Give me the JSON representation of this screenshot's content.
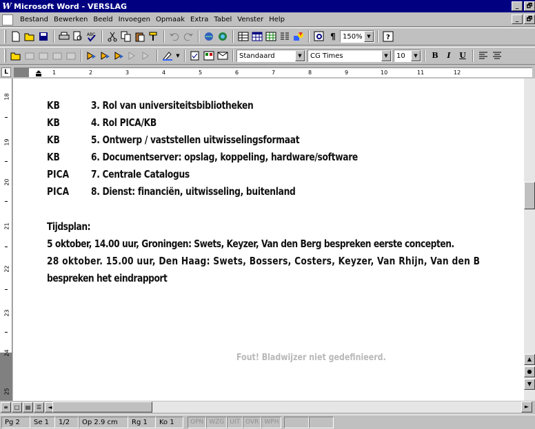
{
  "window": {
    "title": "Microsoft Word - VERSLAG",
    "logo": "W",
    "minimize": "_",
    "restore": "🗗",
    "close": "✕"
  },
  "menu": [
    "Bestand",
    "Bewerken",
    "Beeld",
    "Invoegen",
    "Opmaak",
    "Extra",
    "Tabel",
    "Venster",
    "Help"
  ],
  "toolbar1": {
    "zoom": "150%"
  },
  "toolbar2": {
    "style": "Standaard",
    "font": "CG Times",
    "size": "10",
    "bold": "B",
    "italic": "I",
    "underline": "U"
  },
  "ruler": {
    "tab_selector": "L",
    "ticks": [
      "1",
      "2",
      "3",
      "4",
      "5",
      "6",
      "7",
      "8",
      "9",
      "10",
      "11",
      "12"
    ],
    "vticks": [
      "18",
      "19",
      "20",
      "21",
      "22",
      "23",
      "24",
      "25"
    ]
  },
  "document": {
    "rows": [
      {
        "org": "KB",
        "item": "3. Rol van universiteitsbibliotheken"
      },
      {
        "org": "KB",
        "item": "4. Rol PICA/KB"
      },
      {
        "org": "KB",
        "item": "5. Ontwerp / vaststellen uitwisselingsformaat"
      },
      {
        "org": "KB",
        "item": "6. Documentserver: opslag, koppeling, hardware/software"
      },
      {
        "org": "PICA",
        "item": "7. Centrale Catalogus"
      },
      {
        "org": "PICA",
        "item": "8. Dienst: financiën, uitwisseling, buitenland"
      }
    ],
    "heading": "Tijdsplan:",
    "line1": "5 oktober, 14.00 uur, Groningen: Swets, Keyzer, Van den Berg bespreken eerste concepten.",
    "line2": "28 oktober. 15.00 uur, Den Haag: Swets, Bossers, Costers, Keyzer, Van Rhijn, Van den B",
    "line3": "bespreken het eindrapport",
    "error": "Fout! Bladwijzer niet gedefinieerd."
  },
  "status": {
    "page": "Pg 2",
    "section": "Se 1",
    "pages": "1/2",
    "position": "Op 2.9 cm",
    "line": "Rg 1",
    "column": "Ko 1",
    "indicators": [
      "OPN",
      "WZG",
      "UIT",
      "OVR",
      "WPH"
    ]
  }
}
